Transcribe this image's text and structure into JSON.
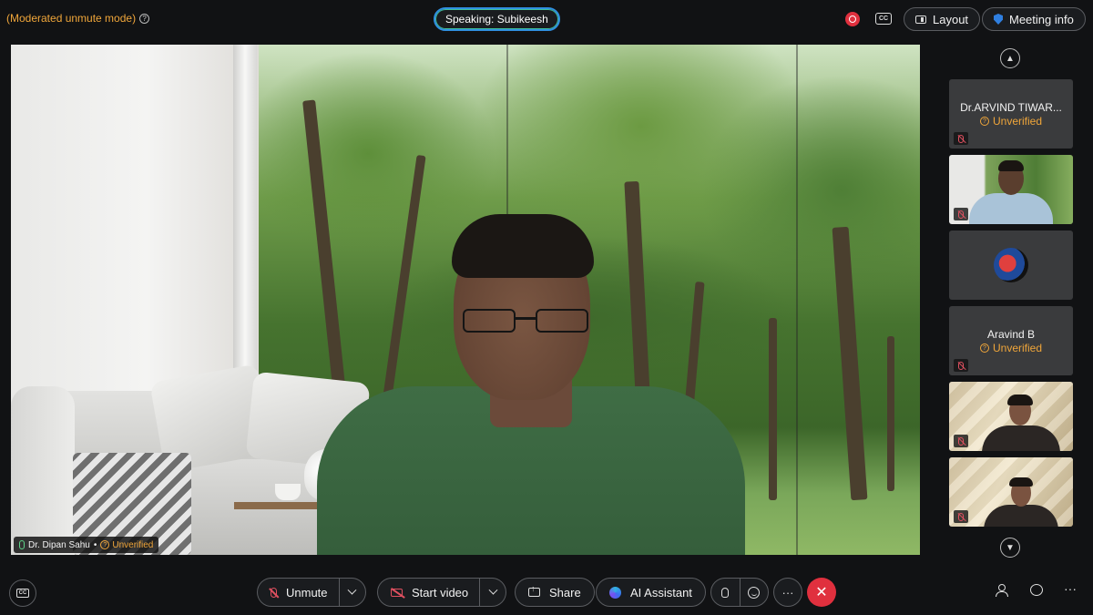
{
  "topbar": {
    "mode_label": "(Moderated unmute mode)",
    "speaking_label": "Speaking: Subikeesh",
    "cc_label": "CC",
    "layout_label": "Layout",
    "meeting_info_label": "Meeting info"
  },
  "main_video": {
    "participant_name": "Dr. Dipan Sahu",
    "separator": "•",
    "status": "Unverified"
  },
  "sidebar": {
    "participants": [
      {
        "name": "Dr.ARVIND TIWAR...",
        "status": "Unverified"
      },
      {
        "name": "",
        "status": ""
      },
      {
        "name": "",
        "status": ""
      },
      {
        "name": "Aravind B",
        "status": "Unverified"
      },
      {
        "name": "",
        "status": ""
      },
      {
        "name": "",
        "status": ""
      }
    ]
  },
  "bottombar": {
    "cc_label": "CC",
    "unmute_label": "Unmute",
    "start_video_label": "Start video",
    "share_label": "Share",
    "ai_assistant_label": "AI Assistant",
    "more_label": "···",
    "hangup_label": "✕",
    "more_options_label": "···"
  },
  "colors": {
    "accent_blue": "#2f8fe0",
    "warning_orange": "#f0a63a",
    "danger_red": "#e0303e",
    "background": "#111214"
  }
}
